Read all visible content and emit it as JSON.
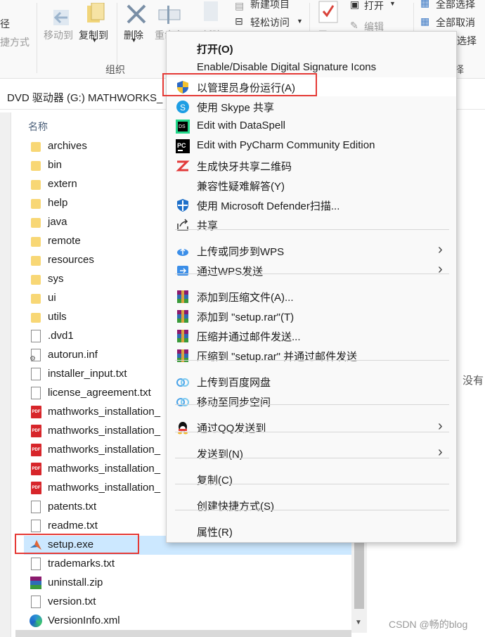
{
  "ribbon": {
    "left_label": "径",
    "left_label2": "捷方式",
    "move_to": "移动到",
    "copy_to": "复制到",
    "delete": "删除",
    "rename_partial": "重命名",
    "new_partial": "新建",
    "new_item": "新建项目",
    "easy_access": "轻松访问",
    "open": "打开",
    "edit": "编辑",
    "select_all": "全部选择",
    "select_none": "全部取消",
    "invert_selection": "选择",
    "group_organize": "组织",
    "select_group_partial": "择"
  },
  "address": {
    "path": "DVD 驱动器 (G:) MATHWORKS_"
  },
  "file_list": {
    "header": "名称",
    "items": [
      {
        "name": "archives",
        "icon": "folder-icon"
      },
      {
        "name": "bin",
        "icon": "folder-icon"
      },
      {
        "name": "extern",
        "icon": "folder-icon"
      },
      {
        "name": "help",
        "icon": "folder-icon"
      },
      {
        "name": "java",
        "icon": "folder-icon"
      },
      {
        "name": "remote",
        "icon": "folder-icon"
      },
      {
        "name": "resources",
        "icon": "folder-icon"
      },
      {
        "name": "sys",
        "icon": "folder-icon"
      },
      {
        "name": "ui",
        "icon": "folder-icon"
      },
      {
        "name": "utils",
        "icon": "folder-icon"
      },
      {
        "name": ".dvd1",
        "icon": "file-icon"
      },
      {
        "name": "autorun.inf",
        "icon": "settings-file-icon"
      },
      {
        "name": "installer_input.txt",
        "icon": "text-file-icon"
      },
      {
        "name": "license_agreement.txt",
        "icon": "text-file-icon"
      },
      {
        "name": "mathworks_installation_",
        "icon": "pdf-icon"
      },
      {
        "name": "mathworks_installation_",
        "icon": "pdf-icon"
      },
      {
        "name": "mathworks_installation_",
        "icon": "pdf-icon"
      },
      {
        "name": "mathworks_installation_",
        "icon": "pdf-icon"
      },
      {
        "name": "mathworks_installation_",
        "icon": "pdf-icon"
      },
      {
        "name": "patents.txt",
        "icon": "text-file-icon"
      },
      {
        "name": "readme.txt",
        "icon": "text-file-icon"
      },
      {
        "name": "setup.exe",
        "icon": "matlab-icon",
        "selected": true
      },
      {
        "name": "trademarks.txt",
        "icon": "text-file-icon"
      },
      {
        "name": "uninstall.zip",
        "icon": "zip-icon"
      },
      {
        "name": "version.txt",
        "icon": "text-file-icon"
      },
      {
        "name": "VersionInfo.xml",
        "icon": "edge-icon"
      }
    ]
  },
  "side_text": "没有",
  "watermark": "CSDN @畅的blog",
  "context_menu": {
    "items": [
      {
        "label": "打开(O)",
        "bold": true,
        "icon": ""
      },
      {
        "label": "Enable/Disable Digital Signature Icons",
        "icon": ""
      },
      {
        "label": "以管理员身份运行(A)",
        "icon": "uac-shield-icon",
        "highlighted": true
      },
      {
        "label": "使用 Skype 共享",
        "icon": "skype-icon"
      },
      {
        "label": "Edit with DataSpell",
        "icon": "dataspell-icon"
      },
      {
        "label": "Edit with PyCharm Community Edition",
        "icon": "pycharm-icon"
      },
      {
        "label": "生成快牙共享二维码",
        "icon": "kuaiya-icon"
      },
      {
        "label": "兼容性疑难解答(Y)",
        "icon": ""
      },
      {
        "label": "使用 Microsoft Defender扫描...",
        "icon": "defender-icon"
      },
      {
        "label": "共享",
        "icon": "share-icon"
      },
      {
        "label": "上传或同步到WPS",
        "icon": "wps-cloud-icon",
        "submenu": true
      },
      {
        "label": "通过WPS发送",
        "icon": "wps-send-icon",
        "submenu": true
      },
      {
        "label": "添加到压缩文件(A)...",
        "icon": "winrar-icon"
      },
      {
        "label": "添加到 \"setup.rar\"(T)",
        "icon": "winrar-icon"
      },
      {
        "label": "压缩并通过邮件发送...",
        "icon": "winrar-icon"
      },
      {
        "label": "压缩到 \"setup.rar\" 并通过邮件发送",
        "icon": "winrar-icon"
      },
      {
        "label": "上传到百度网盘",
        "icon": "baidu-netdisk-icon"
      },
      {
        "label": "移动至同步空间",
        "icon": "baidu-sync-icon"
      },
      {
        "label": "通过QQ发送到",
        "icon": "qq-icon",
        "submenu": true
      },
      {
        "label": "发送到(N)",
        "icon": "",
        "submenu": true
      },
      {
        "label": "复制(C)",
        "icon": ""
      },
      {
        "label": "创建快捷方式(S)",
        "icon": ""
      },
      {
        "label": "属性(R)",
        "icon": ""
      }
    ]
  },
  "colors": {
    "highlight_frame": "#e53935",
    "selection": "#cce8ff",
    "folder": "#f8d775"
  }
}
